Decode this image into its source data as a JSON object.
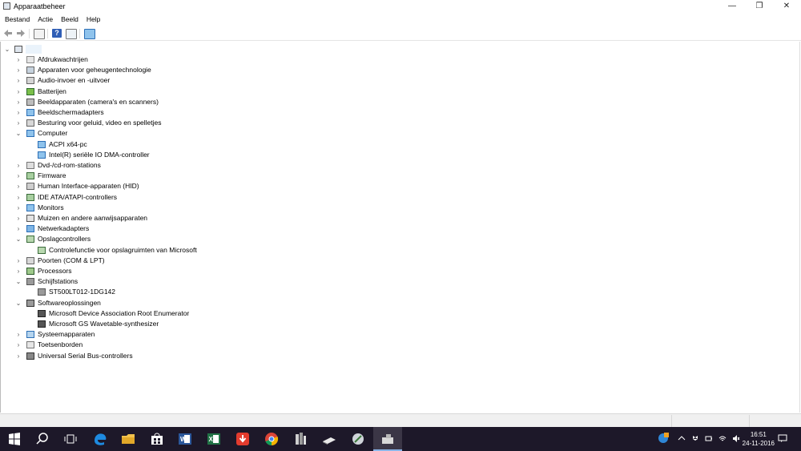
{
  "window": {
    "title": "Apparaatbeheer",
    "controls": {
      "minimize": "—",
      "maximize": "❐",
      "close": "✕"
    }
  },
  "menu": [
    "Bestand",
    "Actie",
    "Beeld",
    "Help"
  ],
  "toolbar": [
    "back-arrow-icon",
    "forward-arrow-icon",
    "properties-icon",
    "help-icon",
    "view-icon",
    "monitor-scan-icon"
  ],
  "tree": {
    "root": {
      "label": "",
      "expanded": true
    },
    "rows": [
      {
        "label": "Afdrukwachtrijen",
        "depth": 1,
        "twisty": "›",
        "icon": "printer-icon"
      },
      {
        "label": "Apparaten voor geheugentechnologie",
        "depth": 1,
        "twisty": "›",
        "icon": "memory-device-icon"
      },
      {
        "label": "Audio-invoer en -uitvoer",
        "depth": 1,
        "twisty": "›",
        "icon": "speaker-icon"
      },
      {
        "label": "Batterijen",
        "depth": 1,
        "twisty": "›",
        "icon": "battery-icon"
      },
      {
        "label": "Beeldapparaten (camera's en scanners)",
        "depth": 1,
        "twisty": "›",
        "icon": "camera-icon"
      },
      {
        "label": "Beeldschermadapters",
        "depth": 1,
        "twisty": "›",
        "icon": "display-adapter-icon"
      },
      {
        "label": "Besturing voor geluid, video en spelletjes",
        "depth": 1,
        "twisty": "›",
        "icon": "sound-icon"
      },
      {
        "label": "Computer",
        "depth": 1,
        "twisty": "⌄",
        "icon": "computer-icon"
      },
      {
        "label": "ACPI x64-pc",
        "depth": 2,
        "twisty": "",
        "icon": "computer-icon"
      },
      {
        "label": "Intel(R) seriële IO DMA-controller",
        "depth": 2,
        "twisty": "",
        "icon": "computer-icon"
      },
      {
        "label": "Dvd-/cd-rom-stations",
        "depth": 1,
        "twisty": "›",
        "icon": "dvd-drive-icon"
      },
      {
        "label": "Firmware",
        "depth": 1,
        "twisty": "›",
        "icon": "firmware-icon"
      },
      {
        "label": "Human Interface-apparaten (HID)",
        "depth": 1,
        "twisty": "›",
        "icon": "hid-icon"
      },
      {
        "label": "IDE ATA/ATAPI-controllers",
        "depth": 1,
        "twisty": "›",
        "icon": "ide-controller-icon"
      },
      {
        "label": "Monitors",
        "depth": 1,
        "twisty": "›",
        "icon": "monitor-icon"
      },
      {
        "label": "Muizen en andere aanwijsapparaten",
        "depth": 1,
        "twisty": "›",
        "icon": "mouse-icon"
      },
      {
        "label": "Netwerkadapters",
        "depth": 1,
        "twisty": "›",
        "icon": "network-adapter-icon"
      },
      {
        "label": "Opslagcontrollers",
        "depth": 1,
        "twisty": "⌄",
        "icon": "storage-controller-icon"
      },
      {
        "label": "Controlefunctie voor opslagruimten van Microsoft",
        "depth": 2,
        "twisty": "",
        "icon": "storage-controller-icon"
      },
      {
        "label": "Poorten (COM & LPT)",
        "depth": 1,
        "twisty": "›",
        "icon": "port-icon"
      },
      {
        "label": "Processors",
        "depth": 1,
        "twisty": "›",
        "icon": "processor-icon"
      },
      {
        "label": "Schijfstations",
        "depth": 1,
        "twisty": "⌄",
        "icon": "disk-drive-icon"
      },
      {
        "label": "ST500LT012-1DG142",
        "depth": 2,
        "twisty": "",
        "icon": "disk-drive-icon"
      },
      {
        "label": "Softwareoplossingen",
        "depth": 1,
        "twisty": "⌄",
        "icon": "software-component-icon"
      },
      {
        "label": "Microsoft Device Association Root Enumerator",
        "depth": 2,
        "twisty": "",
        "icon": "software-device-icon"
      },
      {
        "label": "Microsoft GS Wavetable-synthesizer",
        "depth": 2,
        "twisty": "",
        "icon": "software-device-icon"
      },
      {
        "label": "Systeemapparaten",
        "depth": 1,
        "twisty": "›",
        "icon": "system-device-icon"
      },
      {
        "label": "Toetsenborden",
        "depth": 1,
        "twisty": "›",
        "icon": "keyboard-icon"
      },
      {
        "label": "Universal Serial Bus-controllers",
        "depth": 1,
        "twisty": "›",
        "icon": "usb-icon"
      }
    ]
  },
  "taskbar": {
    "apps": [
      "start-button",
      "search-button",
      "task-view-button",
      "edge-icon",
      "file-explorer-icon",
      "store-icon",
      "word-icon",
      "excel-icon",
      "download-app-icon",
      "chrome-icon",
      "app-icon",
      "drive-app-icon",
      "tool-app-icon",
      "device-manager-taskbar-icon"
    ],
    "clock": {
      "time": "16:51",
      "date": "24-11-2016"
    }
  },
  "colors": {
    "taskbar": "#1d1829",
    "accent": "#2f86d6",
    "status_bar": "#f0f0f0"
  }
}
